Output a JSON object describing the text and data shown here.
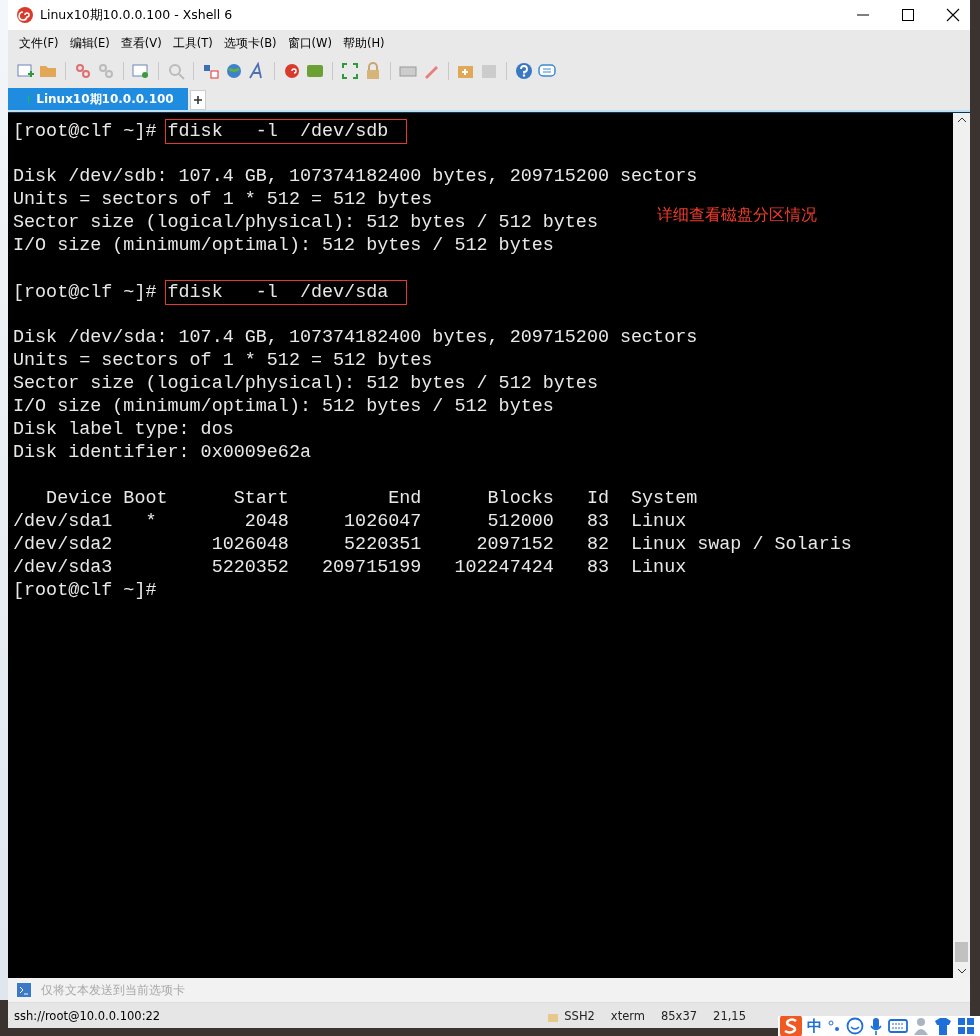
{
  "window": {
    "title": "Linux10期10.0.0.100 - Xshell 6"
  },
  "menu": [
    "文件(F)",
    "编辑(E)",
    "查看(V)",
    "工具(T)",
    "选项卡(B)",
    "窗口(W)",
    "帮助(H)"
  ],
  "tabs": [
    {
      "label": "Linux10期10.0.0.100",
      "selected": true,
      "connected": true
    }
  ],
  "terminal": {
    "lines": [
      {
        "kind": "prompt",
        "prompt": "[root@clf ~]#",
        "command": "fdisk   -l  /dev/sdb",
        "highlighted": true
      },
      {
        "kind": "blank"
      },
      {
        "kind": "output",
        "text": "Disk /dev/sdb: 107.4 GB, 107374182400 bytes, 209715200 sectors"
      },
      {
        "kind": "output",
        "text": "Units = sectors of 1 * 512 = 512 bytes"
      },
      {
        "kind": "output",
        "text": "Sector size (logical/physical): 512 bytes / 512 bytes",
        "note": "详细查看磁盘分区情况"
      },
      {
        "kind": "output",
        "text": "I/O size (minimum/optimal): 512 bytes / 512 bytes"
      },
      {
        "kind": "blank"
      },
      {
        "kind": "prompt",
        "prompt": "[root@clf ~]#",
        "command": "fdisk   -l  /dev/sda",
        "highlighted": true
      },
      {
        "kind": "blank"
      },
      {
        "kind": "output",
        "text": "Disk /dev/sda: 107.4 GB, 107374182400 bytes, 209715200 sectors"
      },
      {
        "kind": "output",
        "text": "Units = sectors of 1 * 512 = 512 bytes"
      },
      {
        "kind": "output",
        "text": "Sector size (logical/physical): 512 bytes / 512 bytes"
      },
      {
        "kind": "output",
        "text": "I/O size (minimum/optimal): 512 bytes / 512 bytes"
      },
      {
        "kind": "output",
        "text": "Disk label type: dos"
      },
      {
        "kind": "output",
        "text": "Disk identifier: 0x0009e62a"
      },
      {
        "kind": "blank"
      },
      {
        "kind": "output",
        "text": "   Device Boot      Start         End      Blocks   Id  System"
      },
      {
        "kind": "output",
        "text": "/dev/sda1   *        2048     1026047      512000   83  Linux"
      },
      {
        "kind": "output",
        "text": "/dev/sda2         1026048     5220351     2097152   82  Linux swap / Solaris"
      },
      {
        "kind": "output",
        "text": "/dev/sda3         5220352   209715199   102247424   83  Linux"
      },
      {
        "kind": "prompt",
        "prompt": "[root@clf ~]#"
      }
    ]
  },
  "send_bar": {
    "placeholder": "仅将文本发送到当前选项卡"
  },
  "status_bar": {
    "address": "ssh://root@10.0.0.100:22",
    "items": [
      "SSH2",
      "xterm",
      "85x37",
      "21,15"
    ]
  },
  "ime_bar": {
    "mode": "中"
  }
}
